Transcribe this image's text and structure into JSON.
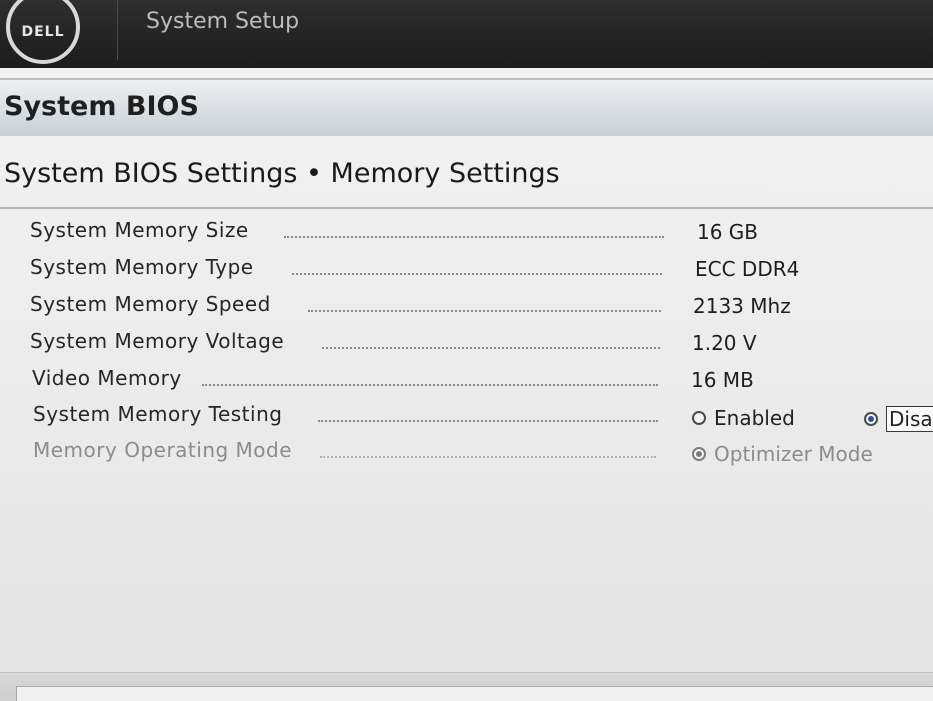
{
  "header": {
    "logo_text": "DELL",
    "app_title": "System Setup"
  },
  "section": {
    "title": "System BIOS"
  },
  "breadcrumb": {
    "text": "System BIOS Settings • Memory Settings"
  },
  "settings": {
    "items": [
      {
        "label": "System Memory Size",
        "value": "16 GB"
      },
      {
        "label": "System Memory Type",
        "value": "ECC DDR4"
      },
      {
        "label": "System Memory Speed",
        "value": "2133 Mhz"
      },
      {
        "label": "System Memory Voltage",
        "value": "1.20 V"
      },
      {
        "label": "Video Memory",
        "value": "16 MB"
      },
      {
        "label": "System Memory Testing",
        "options": [
          "Enabled",
          "Disa"
        ],
        "selected": "Disa"
      },
      {
        "label": "Memory Operating Mode",
        "options": [
          "Optimizer Mode"
        ],
        "selected": "Optimizer Mode",
        "disabled": true
      }
    ]
  },
  "colors": {
    "topbar": "#1c1c1c",
    "section_bar": "#c9d0d6",
    "radio_selected": "#2b4fa8"
  }
}
